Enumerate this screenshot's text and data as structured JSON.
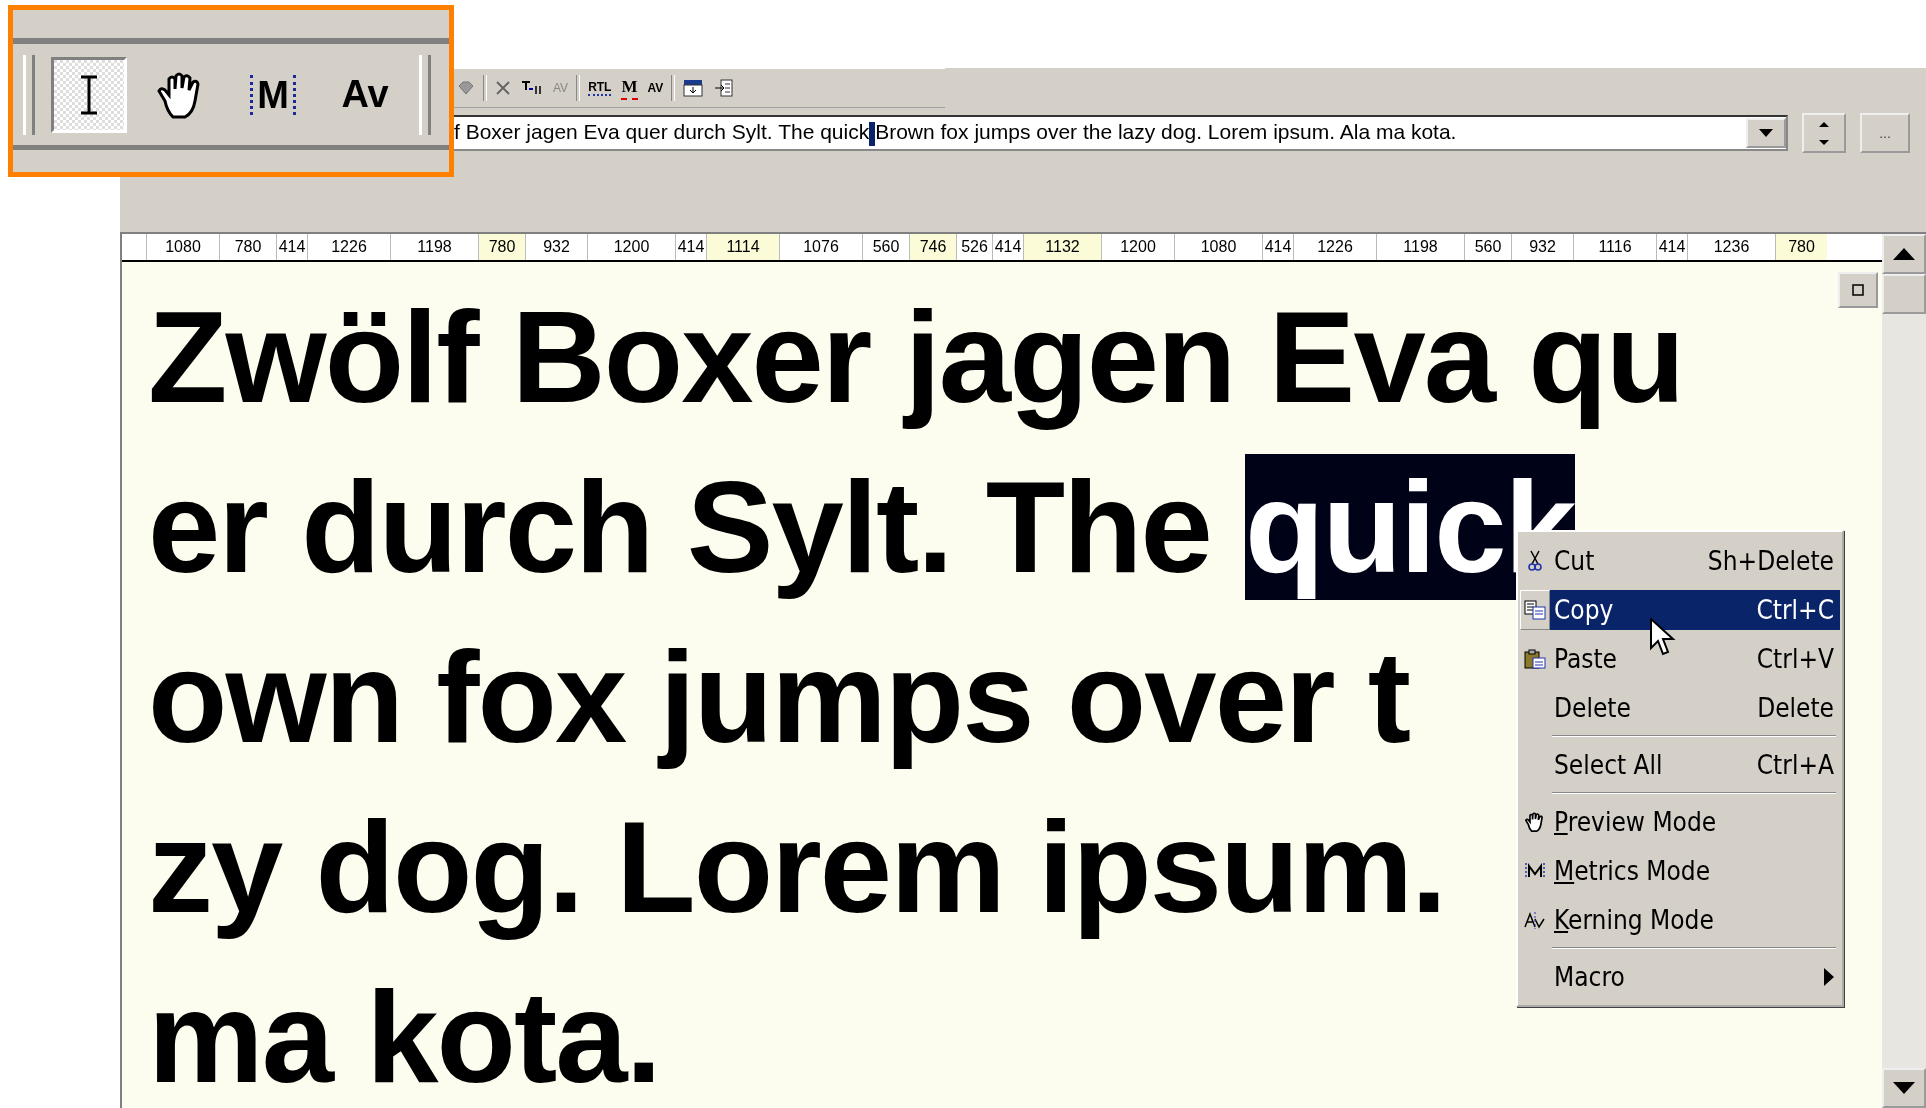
{
  "inset_toolbar": {
    "tools": [
      {
        "kind": "text-cursor",
        "selected": true
      },
      {
        "kind": "hand",
        "selected": false
      },
      {
        "kind": "metrics",
        "label": "M",
        "selected": false
      },
      {
        "kind": "kerning",
        "label": "Av",
        "selected": false
      }
    ]
  },
  "toolbar": {
    "buttons": [
      {
        "kind": "gem"
      },
      {
        "kind": "cross"
      },
      {
        "kind": "glyph-list"
      },
      {
        "kind": "add-kern",
        "label": "AV"
      },
      {
        "kind": "rtl",
        "label": "RTL"
      },
      {
        "kind": "metric-line",
        "label": "M"
      },
      {
        "kind": "kern-pairs",
        "label": "AV"
      },
      {
        "kind": "insert-below"
      },
      {
        "kind": "insert-left"
      }
    ]
  },
  "text_combo": {
    "text_before_caret": "f Boxer jagen Eva quer durch Sylt. The quick",
    "text_after_caret": "Brown fox jumps over the lazy dog. Lorem ipsum. Ala ma kota.",
    "more_button": "..."
  },
  "ruler": [
    {
      "text": "1080",
      "highlighted": false
    },
    {
      "text": "780",
      "highlighted": false
    },
    {
      "text": "414",
      "highlighted": false
    },
    {
      "text": "1226",
      "highlighted": false
    },
    {
      "text": "1198",
      "highlighted": false
    },
    {
      "text": "780",
      "highlighted": true
    },
    {
      "text": "932",
      "highlighted": false
    },
    {
      "text": "1200",
      "highlighted": false
    },
    {
      "text": "414",
      "highlighted": false
    },
    {
      "text": "1114",
      "highlighted": true
    },
    {
      "text": "1076",
      "highlighted": false
    },
    {
      "text": "560",
      "highlighted": false
    },
    {
      "text": "746",
      "highlighted": true
    },
    {
      "text": "526",
      "highlighted": false
    },
    {
      "text": "414",
      "highlighted": false
    },
    {
      "text": "1132",
      "highlighted": true
    },
    {
      "text": "1200",
      "highlighted": false
    },
    {
      "text": "1080",
      "highlighted": false
    },
    {
      "text": "414",
      "highlighted": false
    },
    {
      "text": "1226",
      "highlighted": false
    },
    {
      "text": "1198",
      "highlighted": false
    },
    {
      "text": "560",
      "highlighted": false
    },
    {
      "text": "932",
      "highlighted": false
    },
    {
      "text": "1116",
      "highlighted": false
    },
    {
      "text": "414",
      "highlighted": false
    },
    {
      "text": "1236",
      "highlighted": false
    },
    {
      "text": "780",
      "highlighted": true
    }
  ],
  "preview_lines": [
    [
      {
        "text": "Zwölf Boxer jagen Eva qu",
        "selected": false
      }
    ],
    [
      {
        "text": "er durch Sylt. The ",
        "selected": false
      },
      {
        "text": "quick",
        "selected": true
      }
    ],
    [
      {
        "text": "own fox jumps over t",
        "selected": false
      }
    ],
    [
      {
        "text": "zy dog. Lorem ipsum.",
        "selected": false
      }
    ],
    [
      {
        "text": "ma kota.",
        "selected": false
      }
    ]
  ],
  "context_menu": {
    "items": [
      {
        "kind": "cut",
        "label": "Cut",
        "shortcut": "Sh+Delete",
        "selected": false,
        "mnemonic_underlined": false
      },
      {
        "kind": "copy",
        "label": "Copy",
        "shortcut": "Ctrl+C",
        "selected": true,
        "mnemonic_underlined": false
      },
      {
        "kind": "paste",
        "label": "Paste",
        "shortcut": "Ctrl+V",
        "selected": false,
        "mnemonic_underlined": false
      },
      {
        "kind": "plain",
        "label": "Delete",
        "shortcut": "Delete",
        "selected": false,
        "mnemonic_underlined": false
      },
      {
        "kind": "separator"
      },
      {
        "kind": "plain",
        "label": "Select All",
        "shortcut": "Ctrl+A",
        "selected": false,
        "mnemonic_underlined": false
      },
      {
        "kind": "separator"
      },
      {
        "kind": "preview-mode",
        "label": "Preview Mode",
        "selected": false,
        "mnemonic_underlined": true
      },
      {
        "kind": "metrics-mode",
        "label": "Metrics Mode",
        "selected": false,
        "mnemonic_underlined": true
      },
      {
        "kind": "kerning-mode",
        "label": "Kerning Mode",
        "selected": false,
        "mnemonic_underlined": true
      },
      {
        "kind": "separator"
      },
      {
        "kind": "submenu",
        "label": "Macro",
        "selected": false,
        "mnemonic_underlined": false
      }
    ]
  }
}
